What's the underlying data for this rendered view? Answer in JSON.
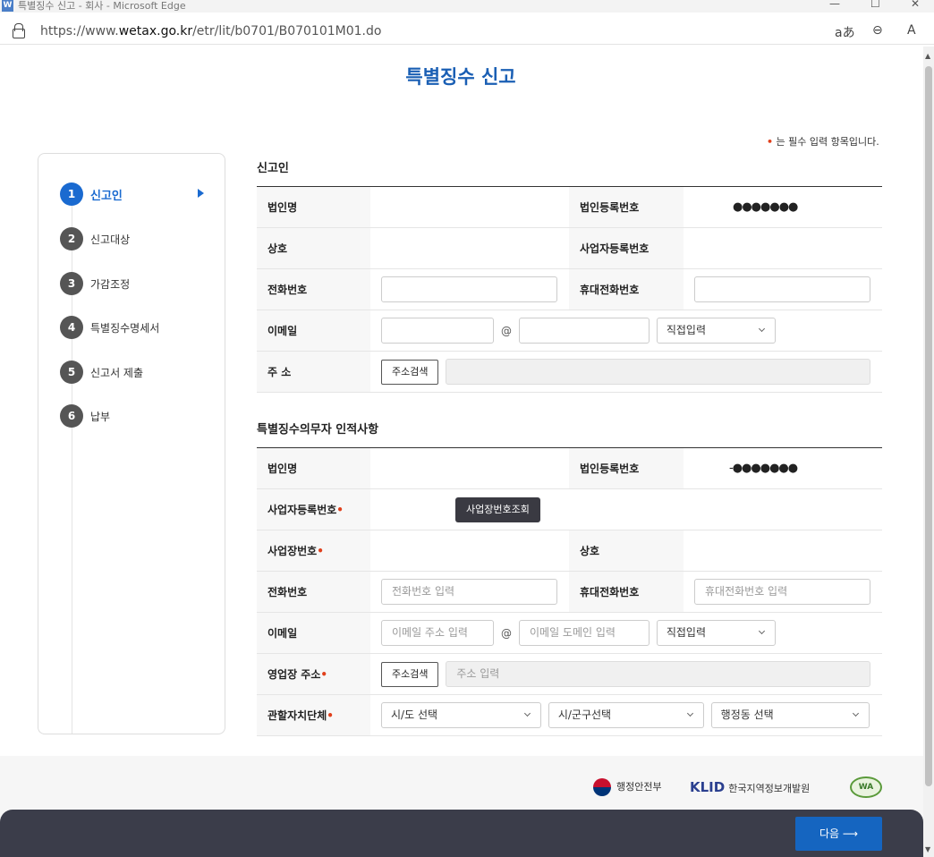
{
  "window": {
    "title": "특별징수 신고 - 회사 - Microsoft Edge"
  },
  "address_bar": {
    "url_prefix": "https://www.",
    "url_domain": "wetax.go.kr",
    "url_path": "/etr/lit/b0701/B070101M01.do"
  },
  "page": {
    "title": "특별징수 신고",
    "required_note": "는 필수 입력 항목입니다."
  },
  "steps": [
    {
      "num": "1",
      "label": "신고인",
      "active": true
    },
    {
      "num": "2",
      "label": "신고대상"
    },
    {
      "num": "3",
      "label": "가감조정"
    },
    {
      "num": "4",
      "label": "특별징수명세서"
    },
    {
      "num": "5",
      "label": "신고서 제출"
    },
    {
      "num": "6",
      "label": "납부"
    }
  ],
  "reporter": {
    "title": "신고인",
    "corp_name_label": "법인명",
    "corp_reg_label": "법인등록번호",
    "corp_reg_value": "●●●●●●●",
    "company_label": "상호",
    "biz_reg_label": "사업자등록번호",
    "phone_label": "전화번호",
    "mobile_label": "휴대전화번호",
    "email_label": "이메일",
    "email_at": "@",
    "email_domain_select": "직접입력",
    "address_label": "주 소",
    "address_search_button": "주소검색"
  },
  "withholder": {
    "title": "특별징수의무자 인적사항",
    "corp_name_label": "법인명",
    "corp_reg_label": "법인등록번호",
    "corp_reg_value": "-●●●●●●●",
    "biz_reg_label": "사업자등록번호",
    "biz_lookup_button": "사업장번호조회",
    "site_no_label": "사업장번호",
    "company_label": "상호",
    "phone_label": "전화번호",
    "phone_placeholder": "전화번호 입력",
    "mobile_label": "휴대전화번호",
    "mobile_placeholder": "휴대전화번호 입력",
    "email_label": "이메일",
    "email_id_placeholder": "이메일 주소 입력",
    "email_at": "@",
    "email_domain_placeholder": "이메일 도메인 입력",
    "email_domain_select": "직접입력",
    "address_label": "영업장 주소",
    "address_search_button": "주소검색",
    "address_placeholder": "주소 입력",
    "jurisdiction_label": "관할자치단체",
    "sido_select": "시/도 선택",
    "sigungu_select": "시/군구선택",
    "dong_select": "행정동 선택"
  },
  "footer": {
    "ministry": "행정안전부",
    "klid_logo": "KLID",
    "klid_name": "한국지역정보개발원",
    "wa_mark": "WA"
  },
  "next_button": "다음 ⟶"
}
